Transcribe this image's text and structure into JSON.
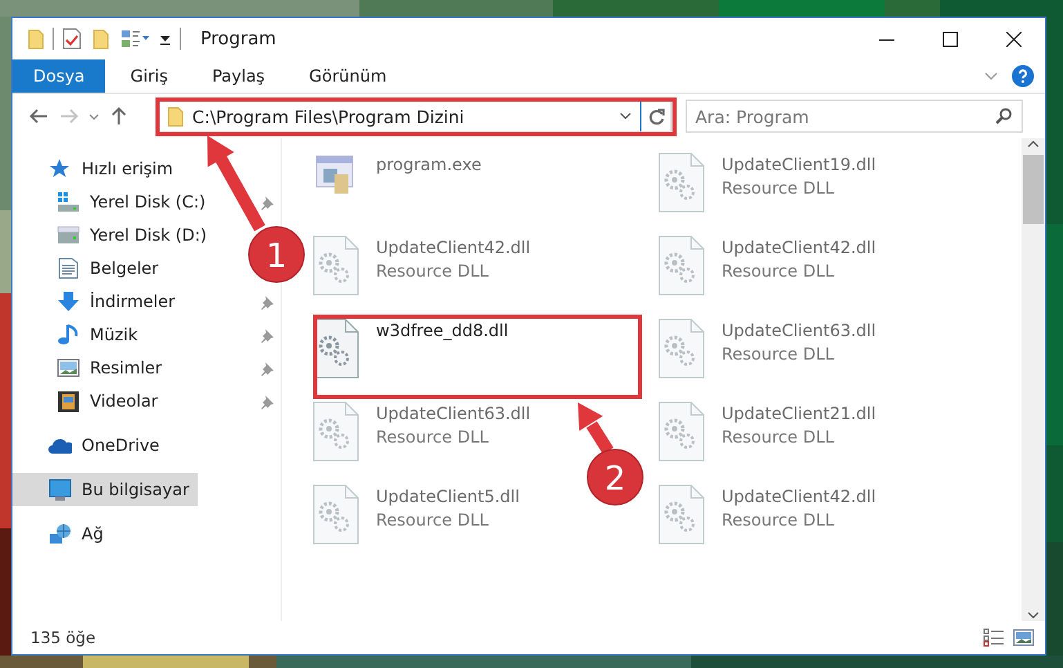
{
  "window": {
    "title": "Program"
  },
  "ribbon_tabs": [
    {
      "label": "Dosya",
      "selected": true
    },
    {
      "label": "Giriş",
      "selected": false
    },
    {
      "label": "Paylaş",
      "selected": false
    },
    {
      "label": "Görünüm",
      "selected": false
    }
  ],
  "address_bar": {
    "value": "C:\\Program Files\\Program Dizini"
  },
  "search": {
    "placeholder": "Ara: Program"
  },
  "sidebar": {
    "items": [
      {
        "label": "Hızlı erişim",
        "kind": "star",
        "selected": false,
        "children": [
          {
            "label": "Yerel Disk (C:)",
            "kind": "system-drive",
            "pinned": true,
            "selected": false
          },
          {
            "label": "Yerel Disk (D:)",
            "kind": "drive",
            "pinned": false,
            "selected": false
          },
          {
            "label": "Belgeler",
            "kind": "documents",
            "pinned": false,
            "selected": false
          },
          {
            "label": "İndirmeler",
            "kind": "downloads",
            "pinned": true,
            "selected": false
          },
          {
            "label": "Müzik",
            "kind": "music",
            "pinned": true,
            "selected": false
          },
          {
            "label": "Resimler",
            "kind": "pictures",
            "pinned": true,
            "selected": false
          },
          {
            "label": "Videolar",
            "kind": "videos",
            "pinned": true,
            "selected": false
          }
        ]
      },
      {
        "label": "OneDrive",
        "kind": "cloud",
        "selected": false
      },
      {
        "label": "Bu bilgisayar",
        "kind": "computer",
        "selected": true
      },
      {
        "label": "Ağ",
        "kind": "network",
        "selected": false
      }
    ]
  },
  "files": [
    {
      "name": "program.exe",
      "kind": "exe",
      "blurred": true
    },
    {
      "name": "UpdateClient19.dll",
      "type": "Resource DLL",
      "kind": "dll",
      "blurred": true
    },
    {
      "name": "UpdateClient42.dll",
      "type": "Resource DLL",
      "kind": "dll",
      "blurred": true
    },
    {
      "name": "UpdateClient42.dll",
      "type": "Resource DLL",
      "kind": "dll",
      "blurred": true
    },
    {
      "name": "w3dfree_dd8.dll",
      "kind": "dll",
      "blurred": false
    },
    {
      "name": "UpdateClient63.dll",
      "type": "Resource DLL",
      "kind": "dll",
      "blurred": true
    },
    {
      "name": "UpdateClient63.dll",
      "type": "Resource DLL",
      "kind": "dll",
      "blurred": true
    },
    {
      "name": "UpdateClient21.dll",
      "type": "Resource DLL",
      "kind": "dll",
      "blurred": true
    },
    {
      "name": "UpdateClient5.dll",
      "type": "Resource DLL",
      "kind": "dll",
      "blurred": true
    },
    {
      "name": "UpdateClient42.dll",
      "type": "Resource DLL",
      "kind": "dll",
      "blurred": true
    }
  ],
  "status_bar": {
    "item_count": "135 öğe"
  },
  "annotations": [
    {
      "label": "1"
    },
    {
      "label": "2"
    }
  ]
}
